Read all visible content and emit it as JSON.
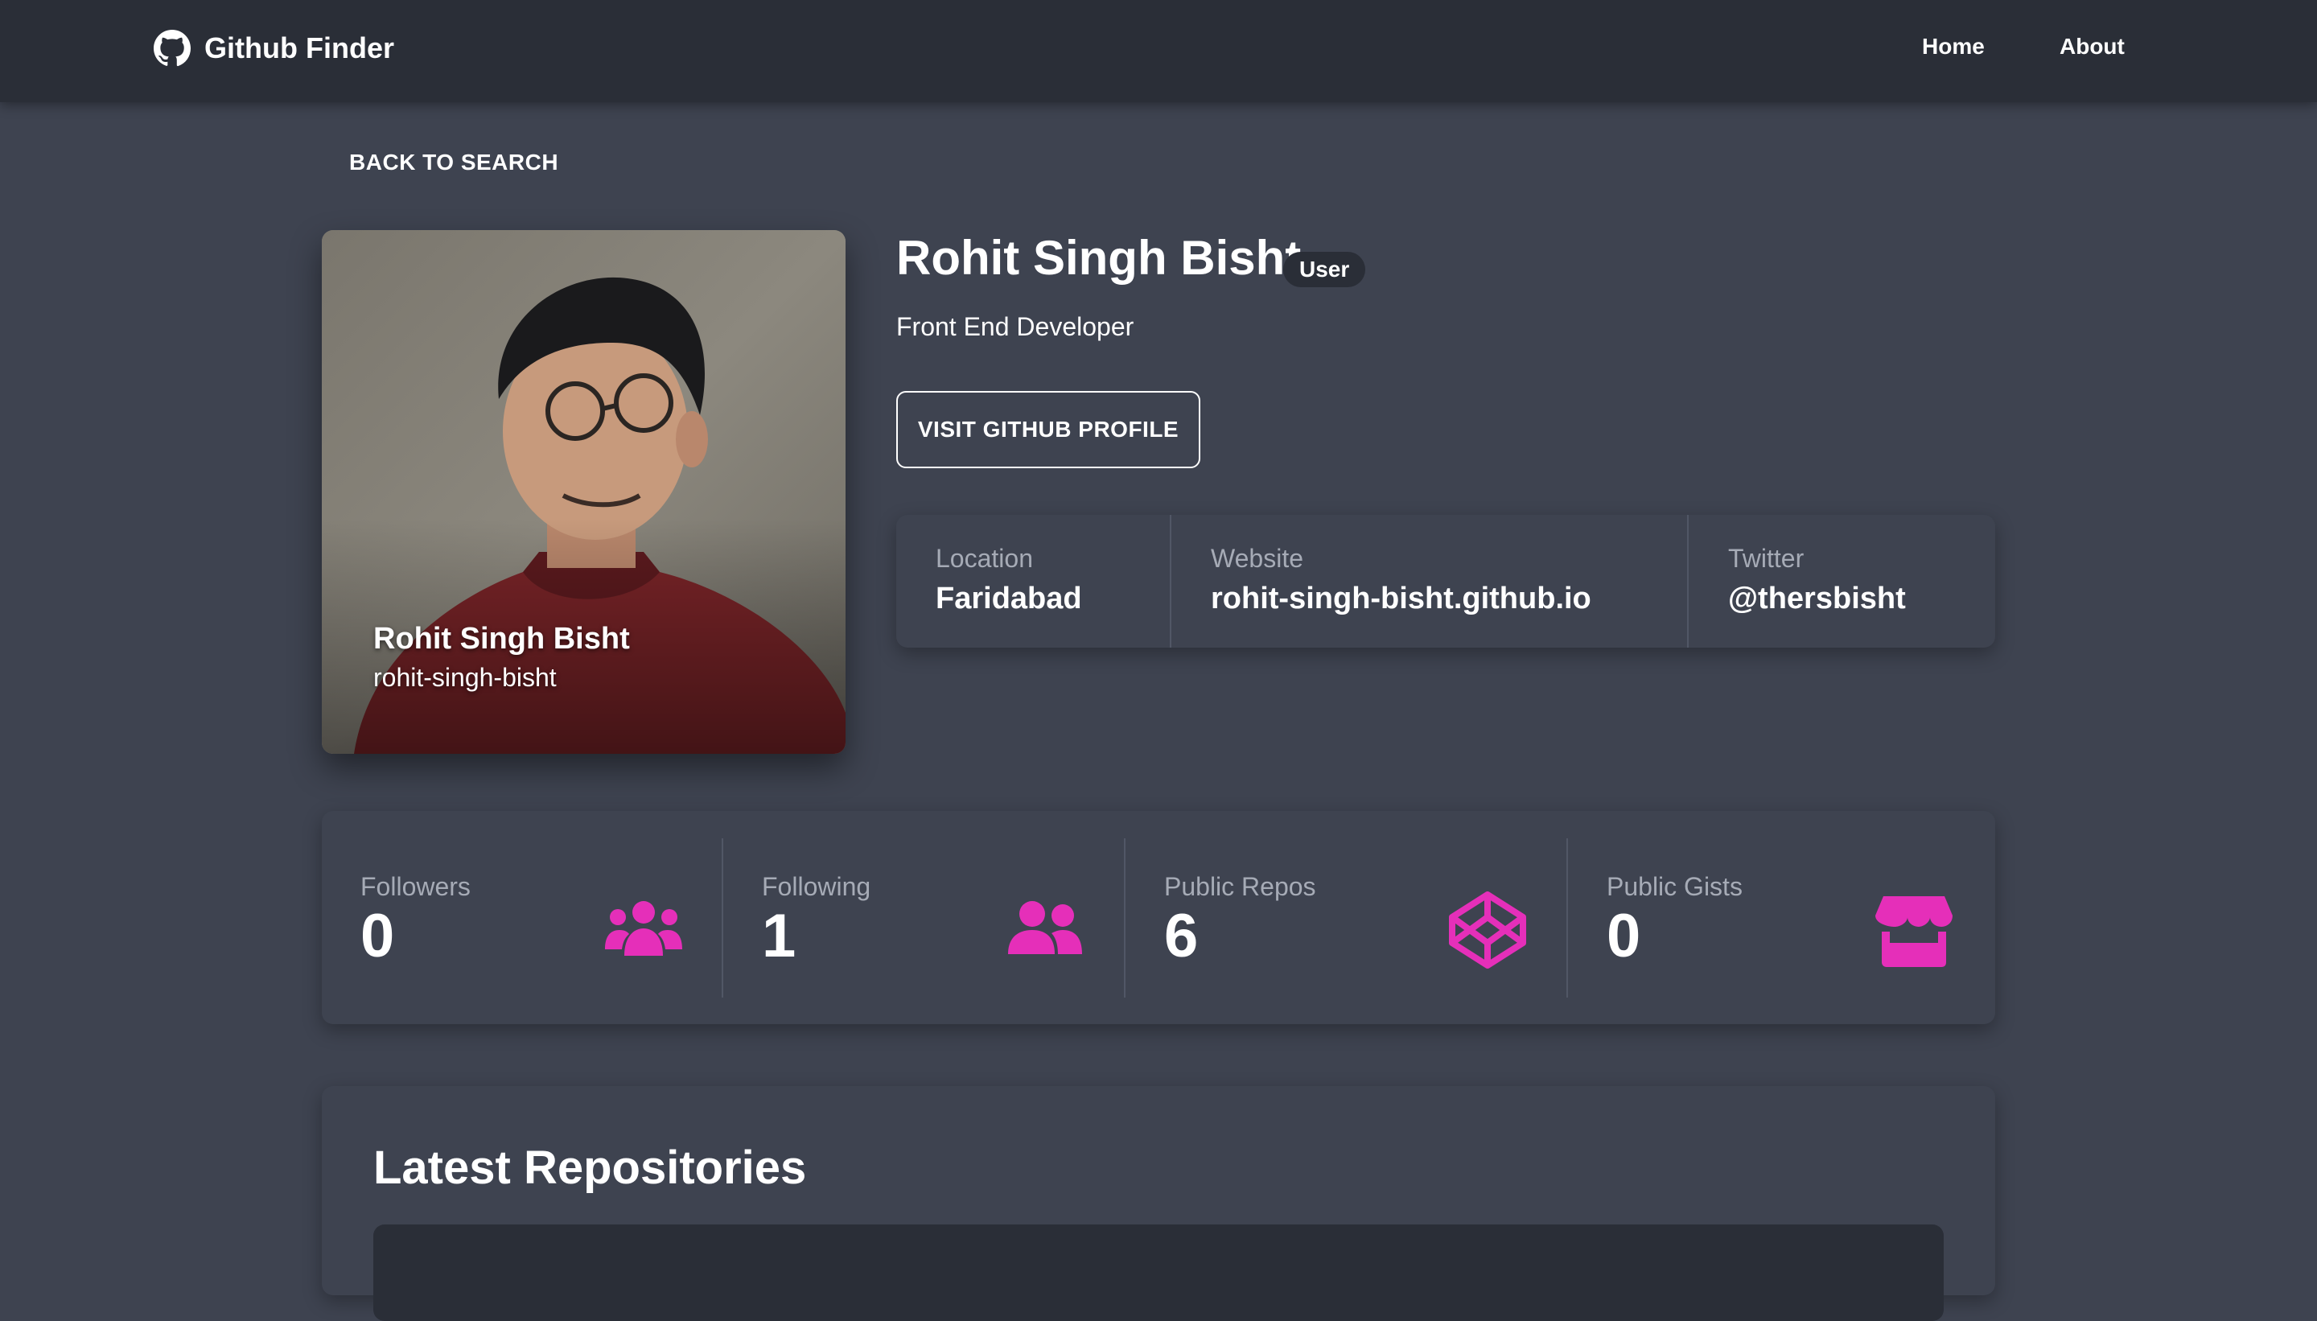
{
  "nav": {
    "brand": "Github Finder",
    "brand_icon": "github-icon",
    "links": [
      {
        "label": "Home"
      },
      {
        "label": "About"
      }
    ]
  },
  "back_button": "BACK TO SEARCH",
  "profile": {
    "name": "Rohit Singh Bisht",
    "login": "rohit-singh-bisht",
    "type_badge": "User",
    "bio": "Front End Developer",
    "visit_button": "VISIT GITHUB PROFILE"
  },
  "info": [
    {
      "label": "Location",
      "value": "Faridabad"
    },
    {
      "label": "Website",
      "value": "rohit-singh-bisht.github.io"
    },
    {
      "label": "Twitter",
      "value": "@thersbisht"
    }
  ],
  "stats": [
    {
      "label": "Followers",
      "value": "0",
      "icon": "users-icon"
    },
    {
      "label": "Following",
      "value": "1",
      "icon": "user-friends-icon"
    },
    {
      "label": "Public Repos",
      "value": "6",
      "icon": "codepen-icon"
    },
    {
      "label": "Public Gists",
      "value": "0",
      "icon": "store-icon"
    }
  ],
  "repos": {
    "title": "Latest Repositories"
  },
  "colors": {
    "accent": "#e52fb9",
    "navbar": "#2a2e37",
    "background": "#3e4350"
  }
}
